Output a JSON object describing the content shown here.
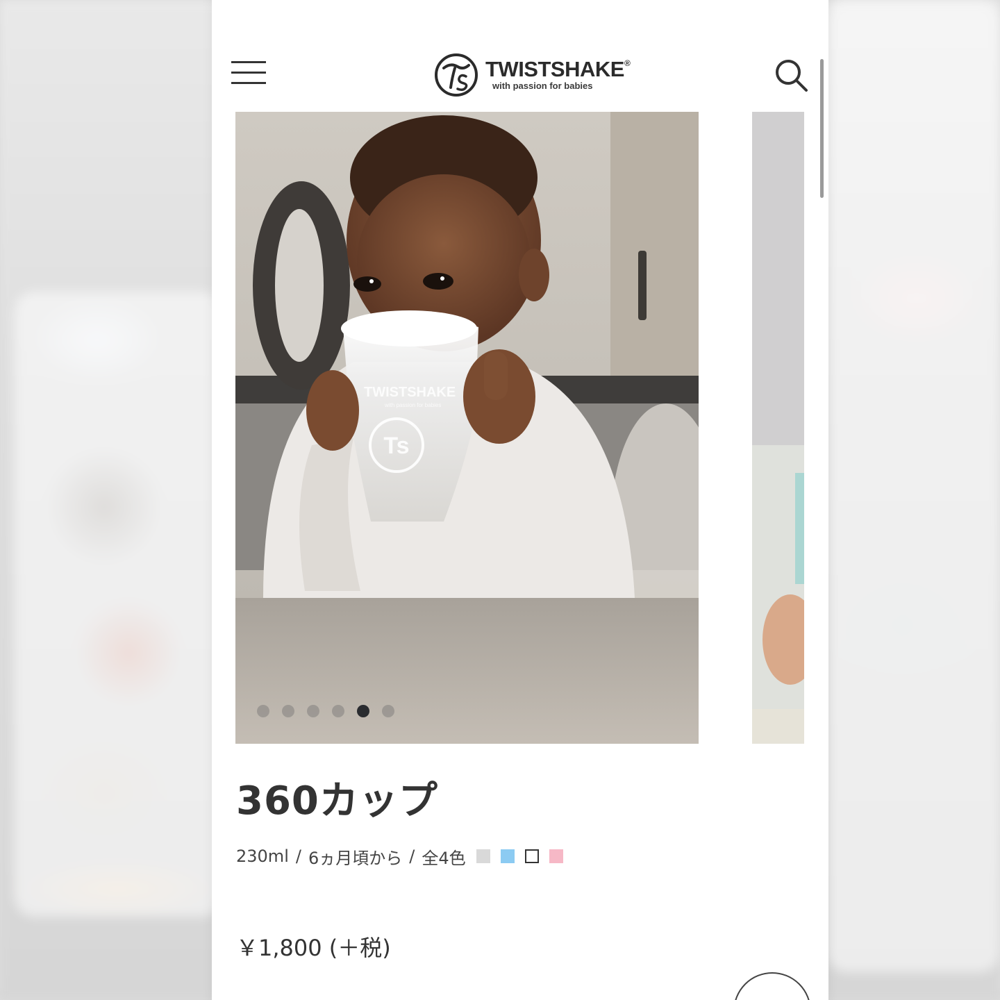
{
  "brand": {
    "name": "TWISTSHAKE",
    "registered_mark": "®",
    "tagline": "with passion for babies",
    "logo_monogram": "Ts"
  },
  "header": {
    "menu_icon": "hamburger-menu-icon",
    "search_icon": "search-icon"
  },
  "carousel": {
    "total_slides": 6,
    "active_index": 4,
    "cup_print_name": "TWISTSHAKE",
    "cup_print_tagline": "with passion for babies",
    "cup_print_monogram": "Ts"
  },
  "product": {
    "name": "360カップ",
    "capacity": "230ml",
    "separator": "/",
    "age": "6ヵ月頃から",
    "colors_label": "全4色",
    "color_swatches": [
      "#d9d9d9",
      "#8ccbf2",
      "#ffffff",
      "#f6b8c6"
    ],
    "price": "￥1,800 (＋税)"
  }
}
